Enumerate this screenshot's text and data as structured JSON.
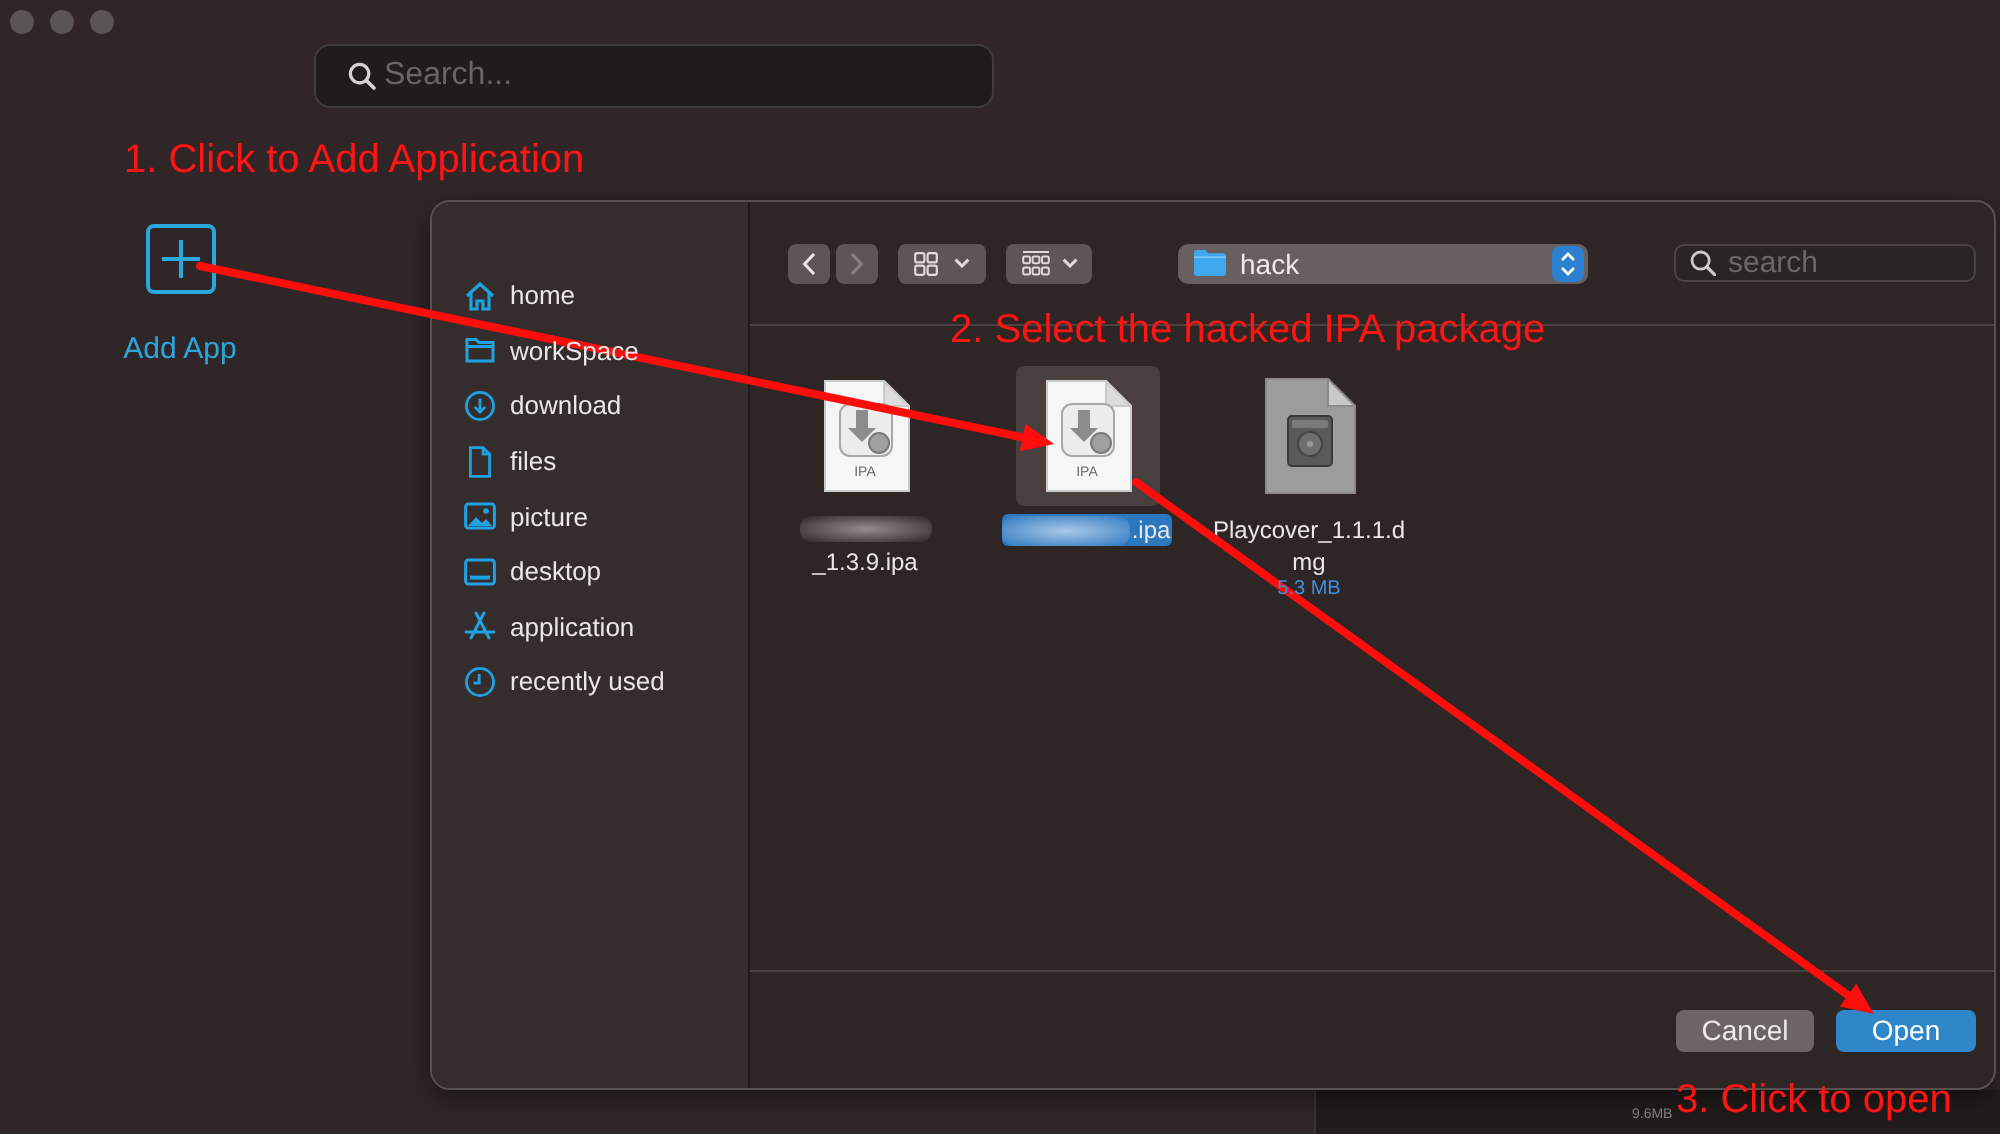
{
  "window": {
    "search": {
      "placeholder": "Search..."
    },
    "add_app": {
      "label": "Add App"
    }
  },
  "dialog": {
    "sidebar": {
      "items": [
        {
          "label": "home",
          "kind": "home"
        },
        {
          "label": "workSpace",
          "kind": "folder"
        },
        {
          "label": "download",
          "kind": "download"
        },
        {
          "label": "files",
          "kind": "document"
        },
        {
          "label": "picture",
          "kind": "picture"
        },
        {
          "label": "desktop",
          "kind": "desktop"
        },
        {
          "label": "application",
          "kind": "apps"
        },
        {
          "label": "recently used",
          "kind": "clock"
        }
      ]
    },
    "toolbar": {
      "back": {
        "disabled": false
      },
      "forward": {
        "disabled": true
      },
      "location": "hack",
      "search": {
        "placeholder": "search"
      }
    },
    "files": [
      {
        "kind": "ipa",
        "icon_label": "IPA",
        "name": "_1.3.9.ipa",
        "blurred": true,
        "blur_own_line": true,
        "selected": false
      },
      {
        "kind": "ipa",
        "icon_label": "IPA",
        "name": ".ipa",
        "blurred": true,
        "blur_own_line": false,
        "selected": true
      },
      {
        "kind": "dmg",
        "name": "Playcover_1.1.1.d\nmg",
        "size": "5.3 MB",
        "selected": false
      }
    ],
    "buttons": [
      {
        "label": "Cancel",
        "kind": "secondary"
      },
      {
        "label": "Open",
        "kind": "primary"
      }
    ]
  },
  "background_window": {
    "size": "9.6MB"
  },
  "annotations": [
    "1. Click to Add Application",
    "2. Select the hacked IPA package",
    "3. Click to open"
  ]
}
